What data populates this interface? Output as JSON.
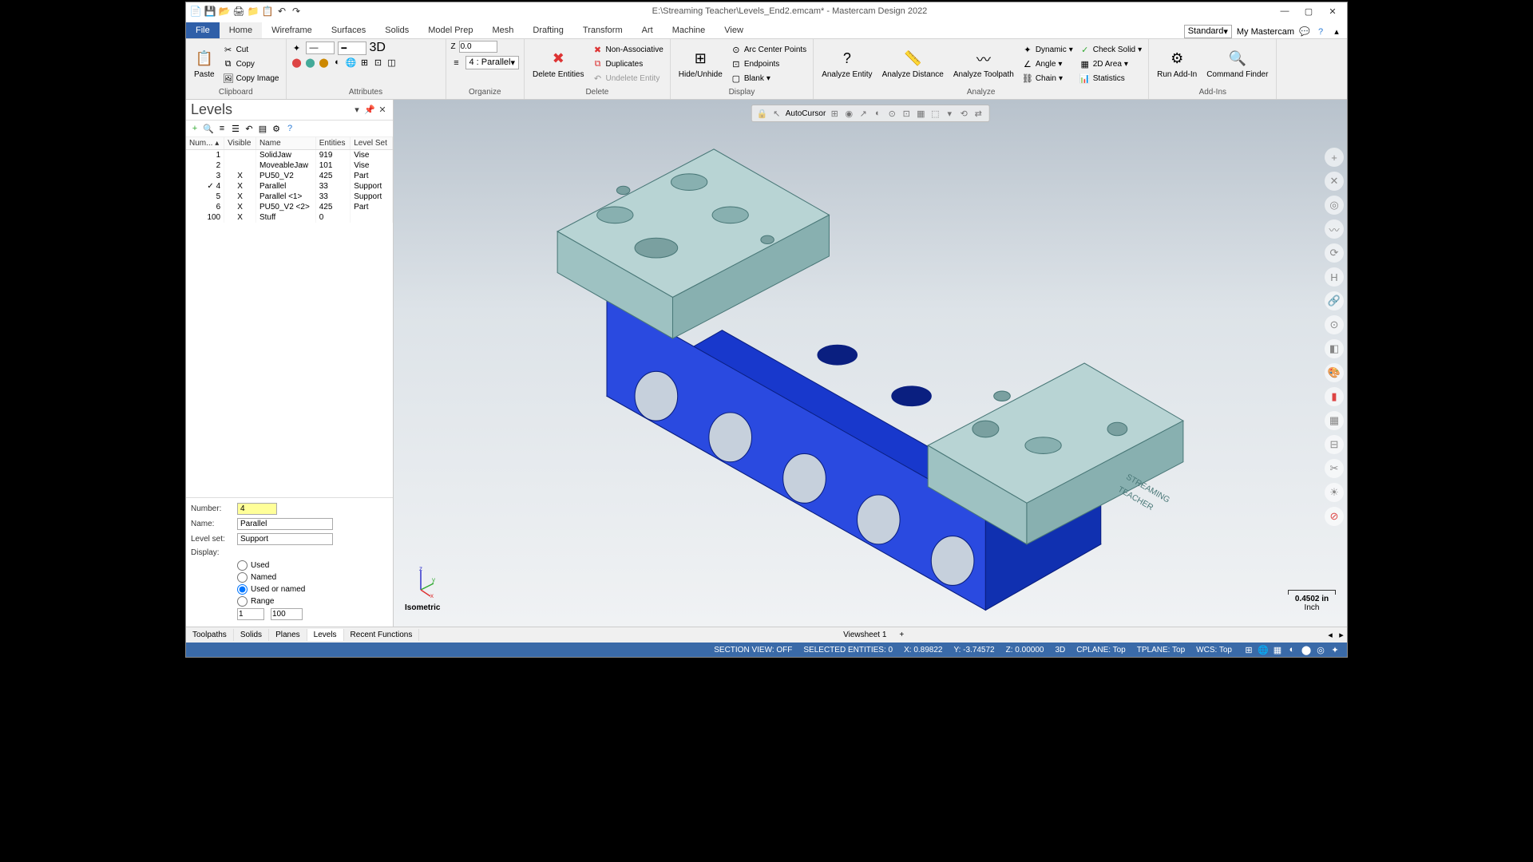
{
  "title": "E:\\Streaming Teacher\\Levels_End2.emcam* - Mastercam Design 2022",
  "tabs": {
    "file": "File",
    "home": "Home",
    "wireframe": "Wireframe",
    "surfaces": "Surfaces",
    "solids": "Solids",
    "modelprep": "Model Prep",
    "mesh": "Mesh",
    "drafting": "Drafting",
    "transform": "Transform",
    "art": "Art",
    "machine": "Machine",
    "view": "View"
  },
  "ribbon_right": {
    "mode": "Standard",
    "my": "My Mastercam"
  },
  "groups": {
    "clipboard": {
      "label": "Clipboard",
      "paste": "Paste",
      "cut": "Cut",
      "copy": "Copy",
      "copyimg": "Copy Image"
    },
    "attributes": {
      "label": "Attributes",
      "z": "Z",
      "zval": "0.0",
      "level": "4 : Parallel",
      "d3": "3D"
    },
    "organize": {
      "label": "Organize"
    },
    "delete": {
      "label": "Delete",
      "de": "Delete Entities",
      "na": "Non-Associative",
      "dup": "Duplicates",
      "ue": "Undelete Entity"
    },
    "display": {
      "label": "Display",
      "hu": "Hide/Unhide",
      "arc": "Arc Center Points",
      "ep": "Endpoints",
      "blank": "Blank"
    },
    "analyze": {
      "label": "Analyze",
      "ae": "Analyze Entity",
      "ad": "Analyze Distance",
      "at": "Analyze Toolpath",
      "dyn": "Dynamic",
      "ang": "Angle",
      "chain": "Chain",
      "cs": "Check Solid",
      "area": "2D Area",
      "stats": "Statistics"
    },
    "addins": {
      "label": "Add-Ins",
      "run": "Run Add-In",
      "cf": "Command Finder"
    }
  },
  "panel": {
    "title": "Levels",
    "cols": {
      "num": "Num...",
      "vis": "Visible",
      "name": "Name",
      "ent": "Entities",
      "set": "Level Set"
    },
    "rows": [
      {
        "n": "1",
        "v": "",
        "name": "SolidJaw",
        "e": "919",
        "s": "Vise"
      },
      {
        "n": "2",
        "v": "",
        "name": "MoveableJaw",
        "e": "101",
        "s": "Vise"
      },
      {
        "n": "3",
        "v": "X",
        "name": "PU50_V2",
        "e": "425",
        "s": "Part"
      },
      {
        "n": "4",
        "v": "X",
        "name": "Parallel",
        "e": "33",
        "s": "Support"
      },
      {
        "n": "5",
        "v": "X",
        "name": "Parallel <1>",
        "e": "33",
        "s": "Support"
      },
      {
        "n": "6",
        "v": "X",
        "name": "PU50_V2 <2>",
        "e": "425",
        "s": "Part"
      },
      {
        "n": "100",
        "v": "X",
        "name": "Stuff",
        "e": "0",
        "s": ""
      }
    ],
    "form": {
      "number_l": "Number:",
      "number_v": "4",
      "name_l": "Name:",
      "name_v": "Parallel",
      "set_l": "Level set:",
      "set_v": "Support",
      "display_l": "Display:",
      "used": "Used",
      "named": "Named",
      "usedor": "Used or named",
      "range": "Range",
      "r1": "1",
      "r2": "100"
    }
  },
  "float": {
    "ac": "AutoCursor"
  },
  "gnomon": {
    "label": "Isometric"
  },
  "scale": {
    "val": "0.4502 in",
    "unit": "Inch"
  },
  "btabs": {
    "tp": "Toolpaths",
    "so": "Solids",
    "pl": "Planes",
    "lv": "Levels",
    "rf": "Recent Functions",
    "vs": "Viewsheet 1"
  },
  "status": {
    "sec": "SECTION VIEW: OFF",
    "sel": "SELECTED ENTITIES: 0",
    "x": "X: 0.89822",
    "y": "Y: -3.74572",
    "z": "Z: 0.00000",
    "d3": "3D",
    "cp": "CPLANE: Top",
    "tp": "TPLANE: Top",
    "wcs": "WCS: Top"
  }
}
